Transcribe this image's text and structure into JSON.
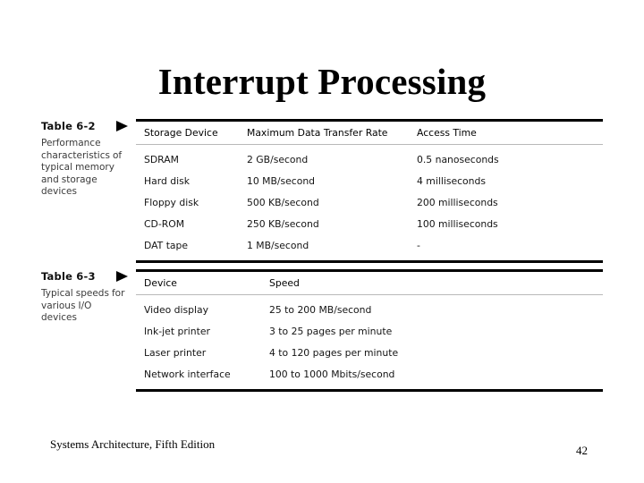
{
  "slide": {
    "title": "Interrupt Processing",
    "footer": "Systems Architecture, Fifth Edition",
    "page_number": "42",
    "background_color": "#ffffff",
    "text_color": "#000000"
  },
  "tables": [
    {
      "caption_title": "Table 6-2",
      "caption_body": "Performance characteristics of typical memory and storage devices",
      "marker_icon": "right-triangle-icon",
      "columns": [
        "Storage Device",
        "Maximum Data Transfer Rate",
        "Access Time"
      ],
      "rows": [
        [
          "SDRAM",
          "2 GB/second",
          "0.5 nanoseconds"
        ],
        [
          "Hard disk",
          "10 MB/second",
          "4 milliseconds"
        ],
        [
          "Floppy disk",
          "500 KB/second",
          "200 milliseconds"
        ],
        [
          "CD-ROM",
          "250 KB/second",
          "100 milliseconds"
        ],
        [
          "DAT tape",
          "1 MB/second",
          "-"
        ]
      ]
    },
    {
      "caption_title": "Table 6-3",
      "caption_body": "Typical speeds for various I/O devices",
      "marker_icon": "right-triangle-icon",
      "columns": [
        "Device",
        "Speed"
      ],
      "rows": [
        [
          "Video display",
          "25 to 200 MB/second"
        ],
        [
          "Ink-jet printer",
          "3 to 25 pages per minute"
        ],
        [
          "Laser printer",
          "4 to 120 pages per minute"
        ],
        [
          "Network interface",
          "100 to 1000 Mbits/second"
        ]
      ]
    }
  ]
}
